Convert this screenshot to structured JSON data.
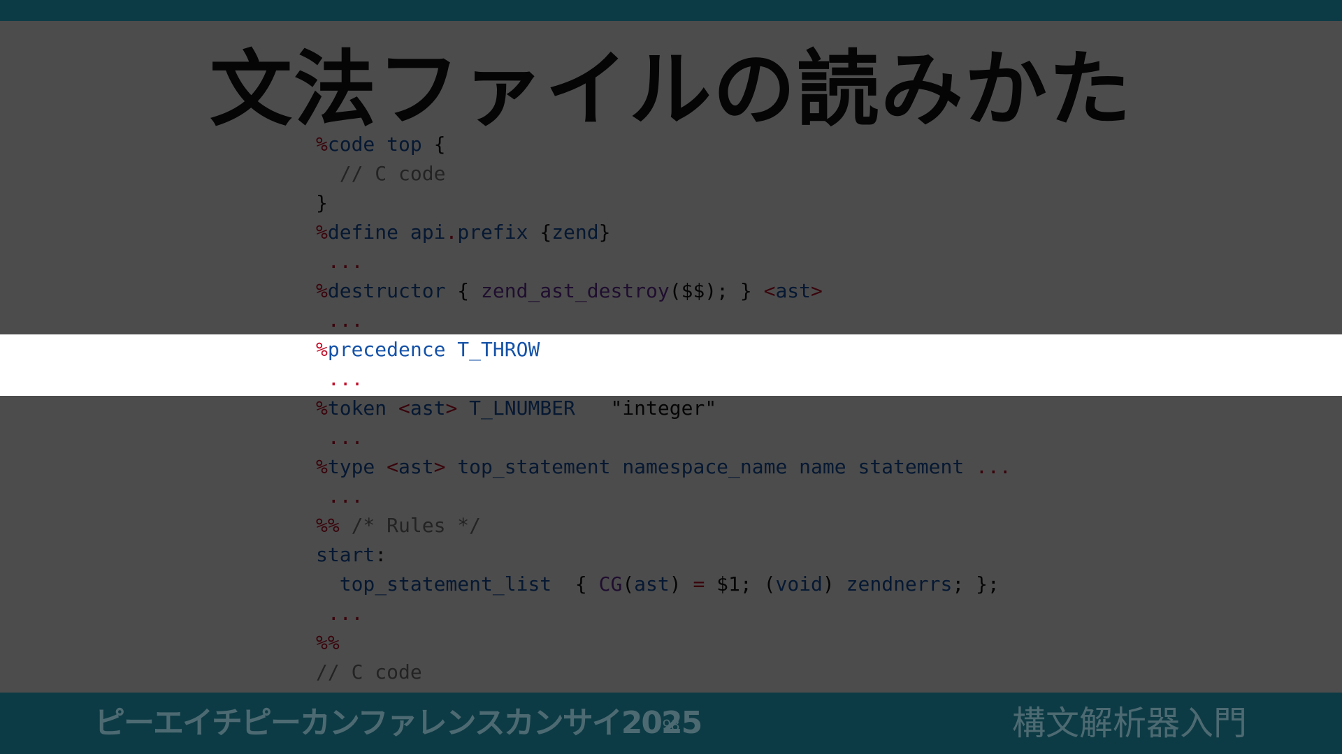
{
  "slide": {
    "title": "文法ファイルの読みかた",
    "code_lines": [
      [
        {
          "t": "%",
          "c": "red"
        },
        {
          "t": "code",
          "c": "blue"
        },
        {
          "t": " "
        },
        {
          "t": "top",
          "c": "blue"
        },
        {
          "t": " {"
        }
      ],
      [
        {
          "t": "  // C code",
          "c": "gray"
        }
      ],
      [
        {
          "t": "}"
        }
      ],
      [
        {
          "t": "%",
          "c": "red"
        },
        {
          "t": "define",
          "c": "blue"
        },
        {
          "t": " "
        },
        {
          "t": "api",
          "c": "blue"
        },
        {
          "t": ".",
          "c": "red"
        },
        {
          "t": "prefix",
          "c": "blue"
        },
        {
          "t": " {"
        },
        {
          "t": "zend",
          "c": "blue"
        },
        {
          "t": "}"
        }
      ],
      [
        {
          "t": " ...",
          "c": "red"
        }
      ],
      [
        {
          "t": "%",
          "c": "red"
        },
        {
          "t": "destructor",
          "c": "blue"
        },
        {
          "t": " { "
        },
        {
          "t": "zend_ast_destroy",
          "c": "purple"
        },
        {
          "t": "($$); } "
        },
        {
          "t": "<",
          "c": "red"
        },
        {
          "t": "ast",
          "c": "blue"
        },
        {
          "t": ">",
          "c": "red"
        }
      ],
      [
        {
          "t": " ...",
          "c": "red"
        }
      ],
      [
        {
          "t": "%",
          "c": "red"
        },
        {
          "t": "precedence",
          "c": "blue"
        },
        {
          "t": " "
        },
        {
          "t": "T_THROW",
          "c": "blue"
        }
      ],
      [
        {
          "t": " ...",
          "c": "red"
        }
      ],
      [
        {
          "t": "%",
          "c": "red"
        },
        {
          "t": "token",
          "c": "blue"
        },
        {
          "t": " "
        },
        {
          "t": "<",
          "c": "red"
        },
        {
          "t": "ast",
          "c": "blue"
        },
        {
          "t": ">",
          "c": "red"
        },
        {
          "t": " "
        },
        {
          "t": "T_LNUMBER",
          "c": "blue"
        },
        {
          "t": "   \"integer\""
        }
      ],
      [
        {
          "t": " ...",
          "c": "red"
        }
      ],
      [
        {
          "t": "%",
          "c": "red"
        },
        {
          "t": "type",
          "c": "blue"
        },
        {
          "t": " "
        },
        {
          "t": "<",
          "c": "red"
        },
        {
          "t": "ast",
          "c": "blue"
        },
        {
          "t": ">",
          "c": "red"
        },
        {
          "t": " "
        },
        {
          "t": "top_statement namespace_name name statement",
          "c": "blue"
        },
        {
          "t": " ...",
          "c": "red"
        }
      ],
      [
        {
          "t": " ...",
          "c": "red"
        }
      ],
      [
        {
          "t": "%%",
          "c": "red"
        },
        {
          "t": " /* Rules */",
          "c": "gray"
        }
      ],
      [
        {
          "t": "start",
          "c": "blue"
        },
        {
          "t": ":"
        }
      ],
      [
        {
          "t": "  "
        },
        {
          "t": "top_statement_list",
          "c": "blue"
        },
        {
          "t": "  { "
        },
        {
          "t": "CG",
          "c": "purple"
        },
        {
          "t": "("
        },
        {
          "t": "ast",
          "c": "blue"
        },
        {
          "t": ") "
        },
        {
          "t": "=",
          "c": "red"
        },
        {
          "t": " $1; ("
        },
        {
          "t": "void",
          "c": "blue"
        },
        {
          "t": ") "
        },
        {
          "t": "zendnerrs",
          "c": "blue"
        },
        {
          "t": "; };"
        }
      ],
      [
        {
          "t": " ...",
          "c": "red"
        }
      ],
      [
        {
          "t": "%%",
          "c": "red"
        }
      ],
      [
        {
          "t": "// C code",
          "c": "gray"
        }
      ]
    ],
    "highlighted_lines": [
      7,
      8
    ]
  },
  "footer": {
    "left": "ピーエイチピーカンファレンスカンサイ2025",
    "page_number": "98",
    "right": "構文解析器入門"
  },
  "colors": {
    "bar": "#0d3b45",
    "code_red": "#c0102a",
    "code_blue": "#1552a8",
    "code_purple": "#6a2f9f",
    "code_gray": "#777777"
  }
}
